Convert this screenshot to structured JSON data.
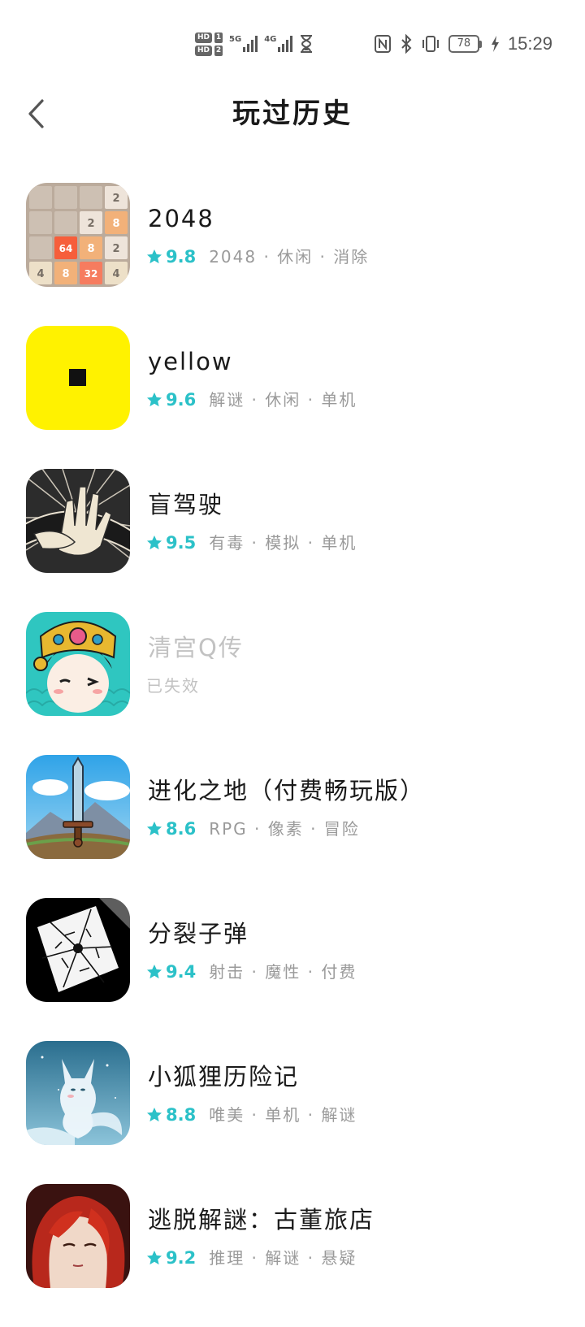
{
  "status_bar": {
    "hd1": "HD",
    "hd2": "HD",
    "sim1": "1",
    "sim2": "2",
    "net1": "5G",
    "net2": "4G",
    "battery": "78",
    "time": "15:29"
  },
  "header": {
    "title": "玩过历史"
  },
  "accent_color": "#2bc1c8",
  "games": [
    {
      "name": "2048",
      "rating": "9.8",
      "tags": "2048 · 休闲 · 消除",
      "icon": "2048-icon"
    },
    {
      "name": "yellow",
      "rating": "9.6",
      "tags": "解谜 · 休闲 · 单机",
      "icon": "yellow-icon"
    },
    {
      "name": "盲驾驶",
      "rating": "9.5",
      "tags": "有毒 · 模拟 · 单机",
      "icon": "blind-drive-icon"
    },
    {
      "name": "清宫Q传",
      "status": "已失效",
      "icon": "qing-palace-icon"
    },
    {
      "name": "进化之地（付费畅玩版）",
      "rating": "8.6",
      "tags": "RPG · 像素 · 冒险",
      "icon": "evoland-icon"
    },
    {
      "name": "分裂子弹",
      "rating": "9.4",
      "tags": "射击 · 魔性 · 付费",
      "icon": "split-bullet-icon"
    },
    {
      "name": "小狐狸历险记",
      "rating": "8.8",
      "tags": "唯美 · 单机 · 解谜",
      "icon": "little-fox-icon"
    },
    {
      "name": "逃脱解謎：古董旅店",
      "rating": "9.2",
      "tags": "推理 · 解谜 · 悬疑",
      "icon": "antique-hotel-icon"
    }
  ]
}
